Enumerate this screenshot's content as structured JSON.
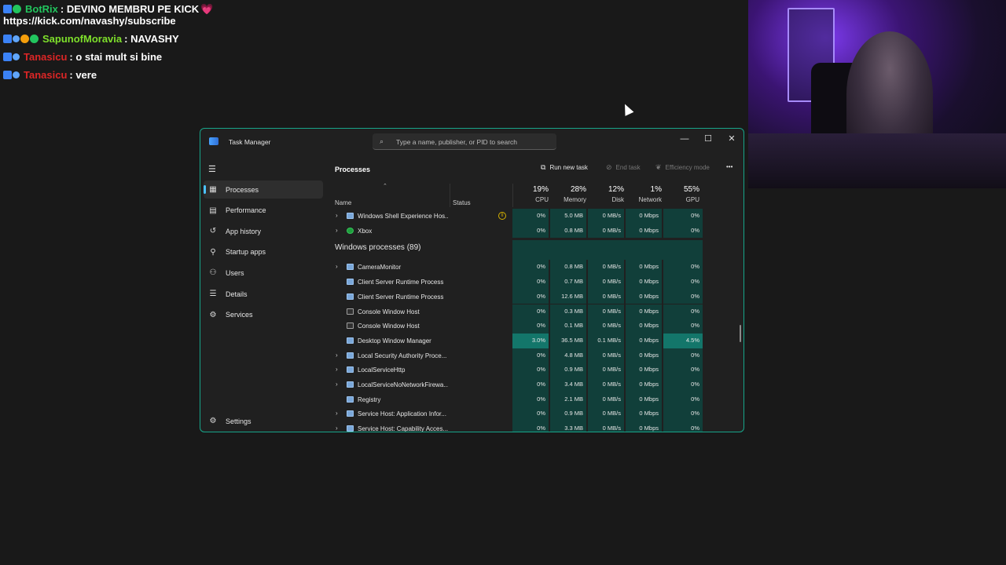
{
  "chat": [
    {
      "user": "BotRix",
      "user_color": "#22c55e",
      "message": ": DEVINO MEMBRU PE KICK",
      "badges": [
        "b1",
        "b2"
      ],
      "heart": "💗"
    },
    {
      "continuation": "https://kick.com/navashy/subscribe"
    },
    {
      "user": "SapunofMoravia",
      "user_color": "#7ee02b",
      "message": ": NAVASHY",
      "badges": [
        "b1",
        "b3",
        "b4",
        "b2"
      ]
    },
    {
      "user": "Tanasicu",
      "user_color": "#dc2626",
      "message": ": o stai mult si bine",
      "badges": [
        "b1",
        "b3"
      ]
    },
    {
      "user": "Tanasicu",
      "user_color": "#dc2626",
      "message": ": vere",
      "badges": [
        "b1",
        "b3"
      ]
    }
  ],
  "window": {
    "title": "Task Manager",
    "search_placeholder": "Type a name, publisher, or PID to search",
    "minimize": "—",
    "maximize": "☐",
    "close": "✕"
  },
  "sidebar": {
    "items": [
      {
        "label": "Processes",
        "icon": "grid-icon",
        "glyph": "▦"
      },
      {
        "label": "Performance",
        "icon": "performance-icon",
        "glyph": "▤"
      },
      {
        "label": "App history",
        "icon": "history-icon",
        "glyph": "↺"
      },
      {
        "label": "Startup apps",
        "icon": "startup-icon",
        "glyph": "⚲"
      },
      {
        "label": "Users",
        "icon": "users-icon",
        "glyph": "⚇"
      },
      {
        "label": "Details",
        "icon": "details-icon",
        "glyph": "☰"
      },
      {
        "label": "Services",
        "icon": "services-icon",
        "glyph": "⚙"
      }
    ],
    "settings": {
      "label": "Settings",
      "glyph": "⚙"
    }
  },
  "toolbar": {
    "title": "Processes",
    "run_new_task": "Run new task",
    "end_task": "End task",
    "efficiency_mode": "Efficiency mode",
    "more": "•••"
  },
  "columns": {
    "name": "Name",
    "status": "Status",
    "cpu": {
      "pct": "19%",
      "label": "CPU"
    },
    "memory": {
      "pct": "28%",
      "label": "Memory"
    },
    "disk": {
      "pct": "12%",
      "label": "Disk"
    },
    "network": {
      "pct": "1%",
      "label": "Network"
    },
    "gpu": {
      "pct": "55%",
      "label": "GPU"
    }
  },
  "rows_top": [
    {
      "name": "Windows Shell Experience Hos...",
      "expand": true,
      "icon": "app",
      "status": "paused",
      "cpu": "0%",
      "memory": "5.0 MB",
      "disk": "0 MB/s",
      "network": "0 Mbps",
      "gpu": "0%"
    },
    {
      "name": "Xbox",
      "expand": true,
      "icon": "xbox",
      "status": "",
      "cpu": "0%",
      "memory": "0.8 MB",
      "disk": "0 MB/s",
      "network": "0 Mbps",
      "gpu": "0%"
    }
  ],
  "group": {
    "title": "Windows processes (89)"
  },
  "rows": [
    {
      "name": "CameraMonitor",
      "expand": true,
      "icon": "app",
      "cpu": "0%",
      "memory": "0.8 MB",
      "disk": "0 MB/s",
      "network": "0 Mbps",
      "gpu": "0%"
    },
    {
      "name": "Client Server Runtime Process",
      "expand": false,
      "icon": "app",
      "cpu": "0%",
      "memory": "0.7 MB",
      "disk": "0 MB/s",
      "network": "0 Mbps",
      "gpu": "0%"
    },
    {
      "name": "Client Server Runtime Process",
      "expand": false,
      "icon": "app",
      "cpu": "0%",
      "memory": "12.6 MB",
      "disk": "0 MB/s",
      "network": "0 Mbps",
      "gpu": "0%"
    },
    {
      "name": "Console Window Host",
      "expand": false,
      "icon": "console",
      "cpu": "0%",
      "memory": "0.3 MB",
      "disk": "0 MB/s",
      "network": "0 Mbps",
      "gpu": "0%"
    },
    {
      "name": "Console Window Host",
      "expand": false,
      "icon": "console",
      "cpu": "0%",
      "memory": "0.1 MB",
      "disk": "0 MB/s",
      "network": "0 Mbps",
      "gpu": "0%"
    },
    {
      "name": "Desktop Window Manager",
      "expand": false,
      "icon": "app",
      "cpu": "3.0%",
      "memory": "36.5 MB",
      "disk": "0.1 MB/s",
      "network": "0 Mbps",
      "gpu": "4.5%",
      "hot": true
    },
    {
      "name": "Local Security Authority Proce...",
      "expand": true,
      "icon": "app",
      "cpu": "0%",
      "memory": "4.8 MB",
      "disk": "0 MB/s",
      "network": "0 Mbps",
      "gpu": "0%"
    },
    {
      "name": "LocalServiceHttp",
      "expand": true,
      "icon": "app",
      "cpu": "0%",
      "memory": "0.9 MB",
      "disk": "0 MB/s",
      "network": "0 Mbps",
      "gpu": "0%"
    },
    {
      "name": "LocalServiceNoNetworkFirewa...",
      "expand": true,
      "icon": "app",
      "cpu": "0%",
      "memory": "3.4 MB",
      "disk": "0 MB/s",
      "network": "0 Mbps",
      "gpu": "0%"
    },
    {
      "name": "Registry",
      "expand": false,
      "icon": "app",
      "cpu": "0%",
      "memory": "2.1 MB",
      "disk": "0 MB/s",
      "network": "0 Mbps",
      "gpu": "0%"
    },
    {
      "name": "Service Host: Application Infor...",
      "expand": true,
      "icon": "app",
      "cpu": "0%",
      "memory": "0.9 MB",
      "disk": "0 MB/s",
      "network": "0 Mbps",
      "gpu": "0%"
    },
    {
      "name": "Service Host: Capability Acces...",
      "expand": true,
      "icon": "app",
      "cpu": "0%",
      "memory": "3.3 MB",
      "disk": "0 MB/s",
      "network": "0 Mbps",
      "gpu": "0%"
    }
  ]
}
